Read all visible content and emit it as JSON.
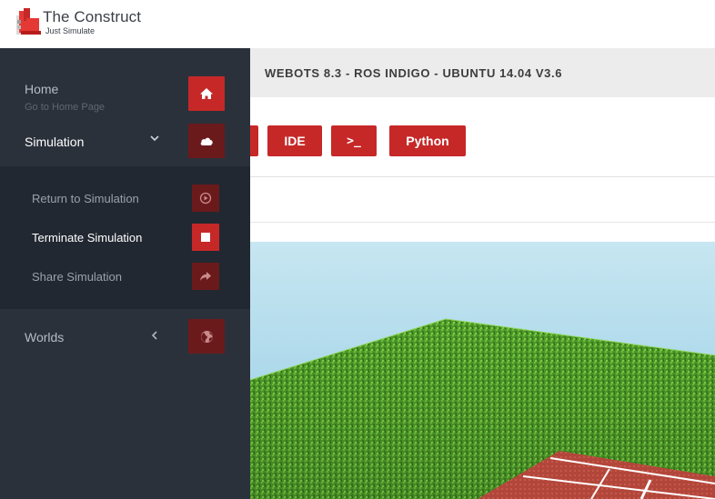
{
  "brand": {
    "name": "The Construct",
    "tagline": "Just Simulate"
  },
  "title_bar": {
    "title": "WEBOTS 8.3 - ROS INDIGO - UBUNTU 14.04 V3.6"
  },
  "toolbar": {
    "buttons": [
      {
        "label": "",
        "icon": "partial-button"
      },
      {
        "label": "IDE"
      },
      {
        "label": ">_",
        "icon": "shell-icon"
      },
      {
        "label": "Python"
      }
    ]
  },
  "sidebar": {
    "home": {
      "label": "Home",
      "sub": "Go to Home Page",
      "icon": "home-icon"
    },
    "simulation": {
      "label": "Simulation",
      "icon": "cloud-icon",
      "expanded": true,
      "items": [
        {
          "label": "Return to Simulation",
          "icon": "play-circle-icon"
        },
        {
          "label": "Terminate Simulation",
          "icon": "stop-icon",
          "active": true
        },
        {
          "label": "Share Simulation",
          "icon": "share-icon"
        }
      ]
    },
    "worlds": {
      "label": "Worlds",
      "icon": "globe-icon",
      "expanded": false
    }
  },
  "colors": {
    "accent": "#c62828",
    "accent_dark": "#6b1a1c",
    "sidebar_bg": "#2b313b",
    "submenu_bg": "#222831"
  }
}
